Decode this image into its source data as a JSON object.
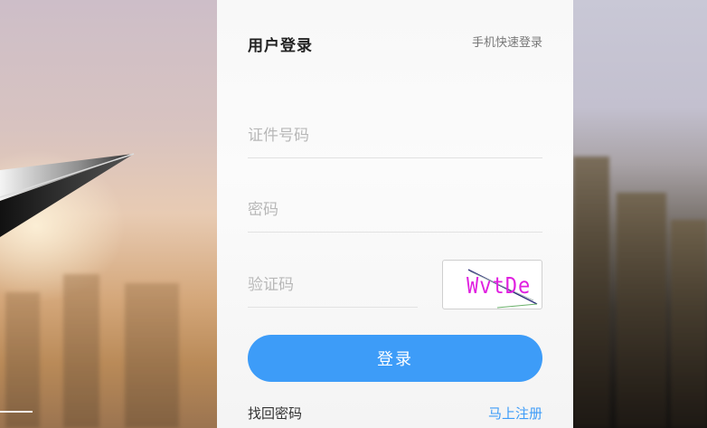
{
  "login": {
    "title": "用户登录",
    "quick_login": "手机快速登录",
    "id_placeholder": "证件号码",
    "password_placeholder": "密码",
    "captcha_placeholder": "验证码",
    "captcha_text": "WvtDe",
    "submit_label": "登录",
    "forgot_password": "找回密码",
    "register": "马上注册"
  },
  "colors": {
    "accent": "#3d9cf8",
    "captcha_text": "#e020e0"
  },
  "background": {
    "icons": [
      "paper-plane-icon"
    ]
  }
}
